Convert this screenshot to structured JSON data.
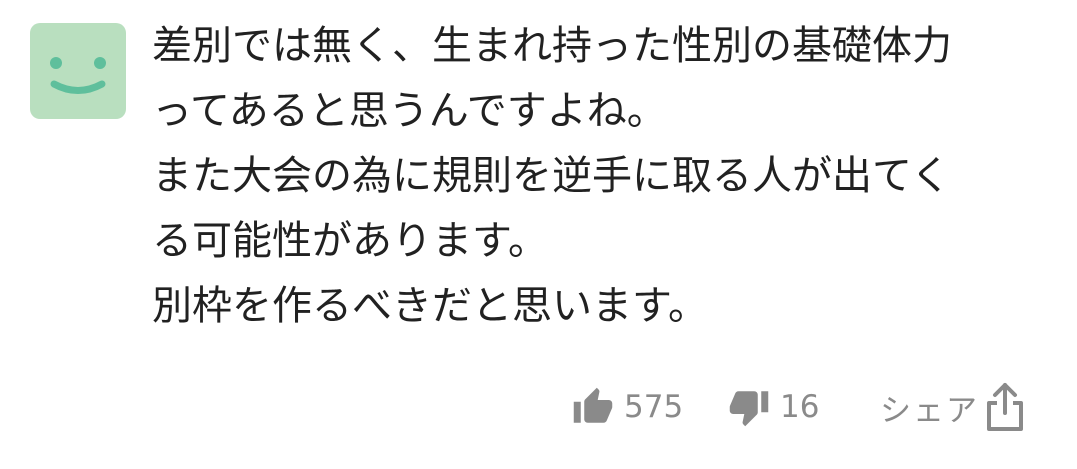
{
  "comment": {
    "avatar_icon": "smiley-face-icon",
    "avatar_color": "#b9dfbf",
    "avatar_face_color": "#5fbf9c",
    "lines": [
      "差別では無く、生まれ持った性別の基礎体力",
      "ってあると思うんですよね。",
      "また大会の為に規則を逆手に取る人が出てく",
      "る可能性があります。",
      "別枠を作るべきだと思います。"
    ]
  },
  "actions": {
    "like_icon": "thumbs-up-icon",
    "like_count": "575",
    "dislike_icon": "thumbs-down-icon",
    "dislike_count": "16",
    "share_label": "シェア",
    "share_icon": "share-icon",
    "icon_color": "#8a8a8a"
  }
}
